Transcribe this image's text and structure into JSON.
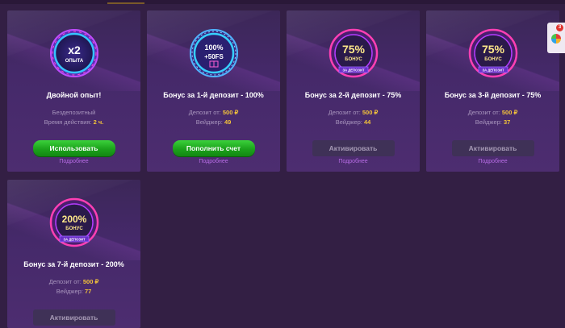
{
  "cards": [
    {
      "badge_main": "x2",
      "badge_sub": "ОПЫТА",
      "title": "Двойной опыт!",
      "info_line1_label": "Бездепозитный",
      "info_line2_label": "Время действия:",
      "info_line2_value": "2 ч.",
      "button_label": "Использовать",
      "more_label": "Подробнее"
    },
    {
      "badge_main": "100%",
      "badge_sub": "+50FS",
      "title": "Бонус за 1-й депозит - 100%",
      "deposit_label": "Депозит от:",
      "deposit_value": "500 ₽",
      "wager_label": "Вейджер:",
      "wager_value": "49",
      "button_label": "Пополнить счет",
      "more_label": "Подробнее"
    },
    {
      "badge_main": "75%",
      "badge_sub": "БОНУС",
      "badge_ribbon": "ЗА ДЕПОЗИТ",
      "title": "Бонус за 2-й депозит - 75%",
      "deposit_label": "Депозит от:",
      "deposit_value": "500 ₽",
      "wager_label": "Вейджер:",
      "wager_value": "44",
      "button_label": "Активировать",
      "more_label": "Подробнее"
    },
    {
      "badge_main": "75%",
      "badge_sub": "БОНУС",
      "badge_ribbon": "ЗА ДЕПОЗИТ",
      "title": "Бонус за 3-й депозит - 75%",
      "deposit_label": "Депозит от:",
      "deposit_value": "500 ₽",
      "wager_label": "Вейджер:",
      "wager_value": "37",
      "button_label": "Активировать",
      "more_label": "Подробнее"
    },
    {
      "badge_main": "200%",
      "badge_sub": "БОНУС",
      "badge_ribbon": "ЗА ДЕПОЗИТ",
      "title": "Бонус за 7-й депозит - 200%",
      "deposit_label": "Депозит от:",
      "deposit_value": "500 ₽",
      "wager_label": "Вейджер:",
      "wager_value": "77",
      "button_label": "Активировать"
    }
  ],
  "side_widget": {
    "count": "3",
    "icon": "wheel-of-fortune-icon"
  },
  "colors": {
    "background": "#331f44",
    "card": "#45296a",
    "green_button": "#1ba21b",
    "highlight": "#f3c33a",
    "link": "#b56be3",
    "badge_blue": "#36b4ff",
    "badge_pink": "#ff3fb4"
  }
}
